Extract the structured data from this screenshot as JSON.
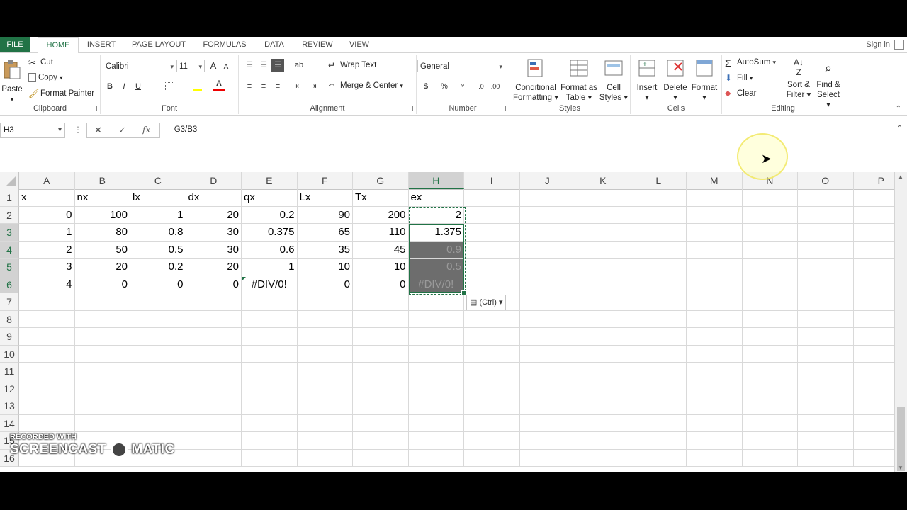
{
  "tabs": [
    "FILE",
    "HOME",
    "INSERT",
    "PAGE LAYOUT",
    "FORMULAS",
    "DATA",
    "REVIEW",
    "VIEW"
  ],
  "sign_in": "Sign in",
  "clipboard": {
    "paste": "Paste",
    "cut": "Cut",
    "copy": "Copy",
    "format_painter": "Format Painter",
    "label": "Clipboard"
  },
  "font": {
    "name": "Calibri",
    "size": "11",
    "label": "Font",
    "bold": "B",
    "italic": "I",
    "underline": "U",
    "grow": "A",
    "shrink": "A"
  },
  "alignment": {
    "wrap": "Wrap Text",
    "merge": "Merge & Center",
    "label": "Alignment"
  },
  "number": {
    "format": "General",
    "label": "Number",
    "percent": "%",
    "comma": "⁹",
    "dollar": "$"
  },
  "styles": {
    "conditional": [
      "Conditional",
      "Formatting"
    ],
    "format_table": [
      "Format as",
      "Table"
    ],
    "cell_styles": [
      "Cell",
      "Styles"
    ],
    "label": "Styles"
  },
  "cells": {
    "insert": "Insert",
    "delete": "Delete",
    "format": "Format",
    "label": "Cells"
  },
  "editing": {
    "autosum": "AutoSum",
    "fill": "Fill",
    "clear": "Clear",
    "sort": [
      "Sort &",
      "Filter"
    ],
    "find": [
      "Find &",
      "Select"
    ],
    "label": "Editing"
  },
  "formula_bar": {
    "name_box": "H3",
    "formula": "=G3/B3",
    "cancel": "✕",
    "enter": "✓",
    "fx": "fx"
  },
  "columns": [
    "A",
    "B",
    "C",
    "D",
    "E",
    "F",
    "G",
    "H",
    "I",
    "J",
    "K",
    "L",
    "M",
    "N",
    "O",
    "P"
  ],
  "rows": [
    "1",
    "2",
    "3",
    "4",
    "5",
    "6",
    "7",
    "8",
    "9",
    "10",
    "11",
    "12",
    "13",
    "14",
    "15",
    "16"
  ],
  "headers_row": [
    "x",
    "nx",
    "lx",
    "dx",
    "qx",
    "Lx",
    "Tx",
    "ex"
  ],
  "data_rows": [
    [
      "0",
      "100",
      "1",
      "20",
      "0.2",
      "90",
      "200",
      "2"
    ],
    [
      "1",
      "80",
      "0.8",
      "30",
      "0.375",
      "65",
      "110",
      "1.375"
    ],
    [
      "2",
      "50",
      "0.5",
      "30",
      "0.6",
      "35",
      "45",
      "0.9"
    ],
    [
      "3",
      "20",
      "0.2",
      "20",
      "1",
      "10",
      "10",
      "0.5"
    ],
    [
      "4",
      "0",
      "0",
      "0",
      "#DIV/0!",
      "0",
      "0",
      "#DIV/0!"
    ]
  ],
  "paste_options": "(Ctrl)",
  "watermark": {
    "line1": "RECORDED WITH",
    "line2": "SCREENCAST",
    "line3": "MATIC"
  },
  "colors": {
    "accent": "#217346",
    "selection_fill": "#6d6d6d"
  }
}
